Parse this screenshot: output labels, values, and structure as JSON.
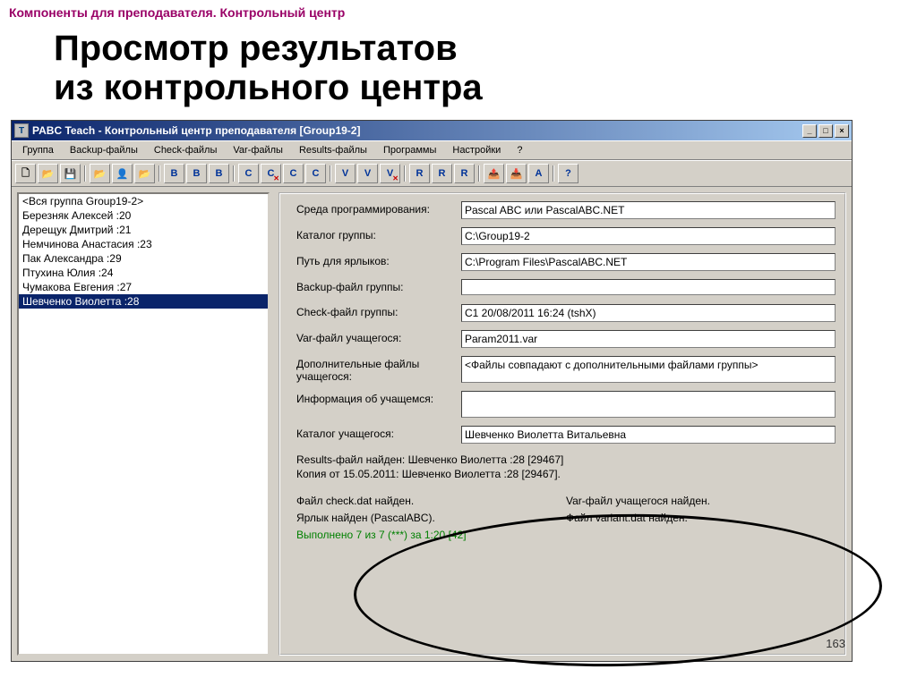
{
  "slide": {
    "header": "Компоненты для преподавателя. Контрольный центр",
    "title_l1": "Просмотр результатов",
    "title_l2": "из контрольного центра",
    "page": "163"
  },
  "window": {
    "title": "PABC Teach - Контрольный центр преподавателя [Group19-2]",
    "icon_letter": "T"
  },
  "menu": {
    "group": "Группа",
    "backup": "Backup-файлы",
    "check": "Check-файлы",
    "var": "Var-файлы",
    "results": "Results-файлы",
    "programs": "Программы",
    "settings": "Настройки",
    "help": "?"
  },
  "toolbar": {
    "b": "B",
    "c": "C",
    "v": "V",
    "r": "R",
    "a": "A",
    "q": "?"
  },
  "students": {
    "header": "<Вся группа Group19-2>",
    "list": [
      "Березняк Алексей :20",
      "Дерещук Дмитрий :21",
      "Немчинова Анастасия :23",
      "Пак Александра :29",
      "Птухина Юлия :24",
      "Чумакова Евгения :27",
      "Шевченко Виолетта :28"
    ],
    "selected_index": 6
  },
  "form": {
    "env_lbl": "Среда программирования:",
    "env_val": "Pascal ABC или PascalABC.NET",
    "dir_lbl": "Каталог группы:",
    "dir_val": "C:\\Group19-2",
    "path_lbl": "Путь для ярлыков:",
    "path_val": "C:\\Program Files\\PascalABC.NET",
    "bkp_lbl": "Backup-файл группы:",
    "bkp_val": "",
    "chk_lbl": "Check-файл группы:",
    "chk_val": "C1 20/08/2011 16:24 (tshX)",
    "var_lbl": "Var-файл учащегося:",
    "var_val": "Param2011.var",
    "add_lbl": "Дополнительные файлы учащегося:",
    "add_val": "<Файлы совпадают с дополнительными файлами группы>",
    "info_lbl": "Информация об учащемся:",
    "info_val": "",
    "sdir_lbl": "Каталог учащегося:",
    "sdir_val": "Шевченко Виолетта Витальевна"
  },
  "results": {
    "line1": "Results-файл найден: Шевченко Виолетта :28 [29467]",
    "line2": "Копия от 15.05.2011: Шевченко Виолетта :28 [29467].",
    "check_found": "Файл check.dat найден.",
    "var_found": "Var-файл учащегося найден.",
    "shortcut_found": "Ярлык найден (PascalABC).",
    "variant_found": "Файл variant.dat найден.",
    "done": "Выполнено 7 из 7 (***) за 1:20 [42]"
  }
}
